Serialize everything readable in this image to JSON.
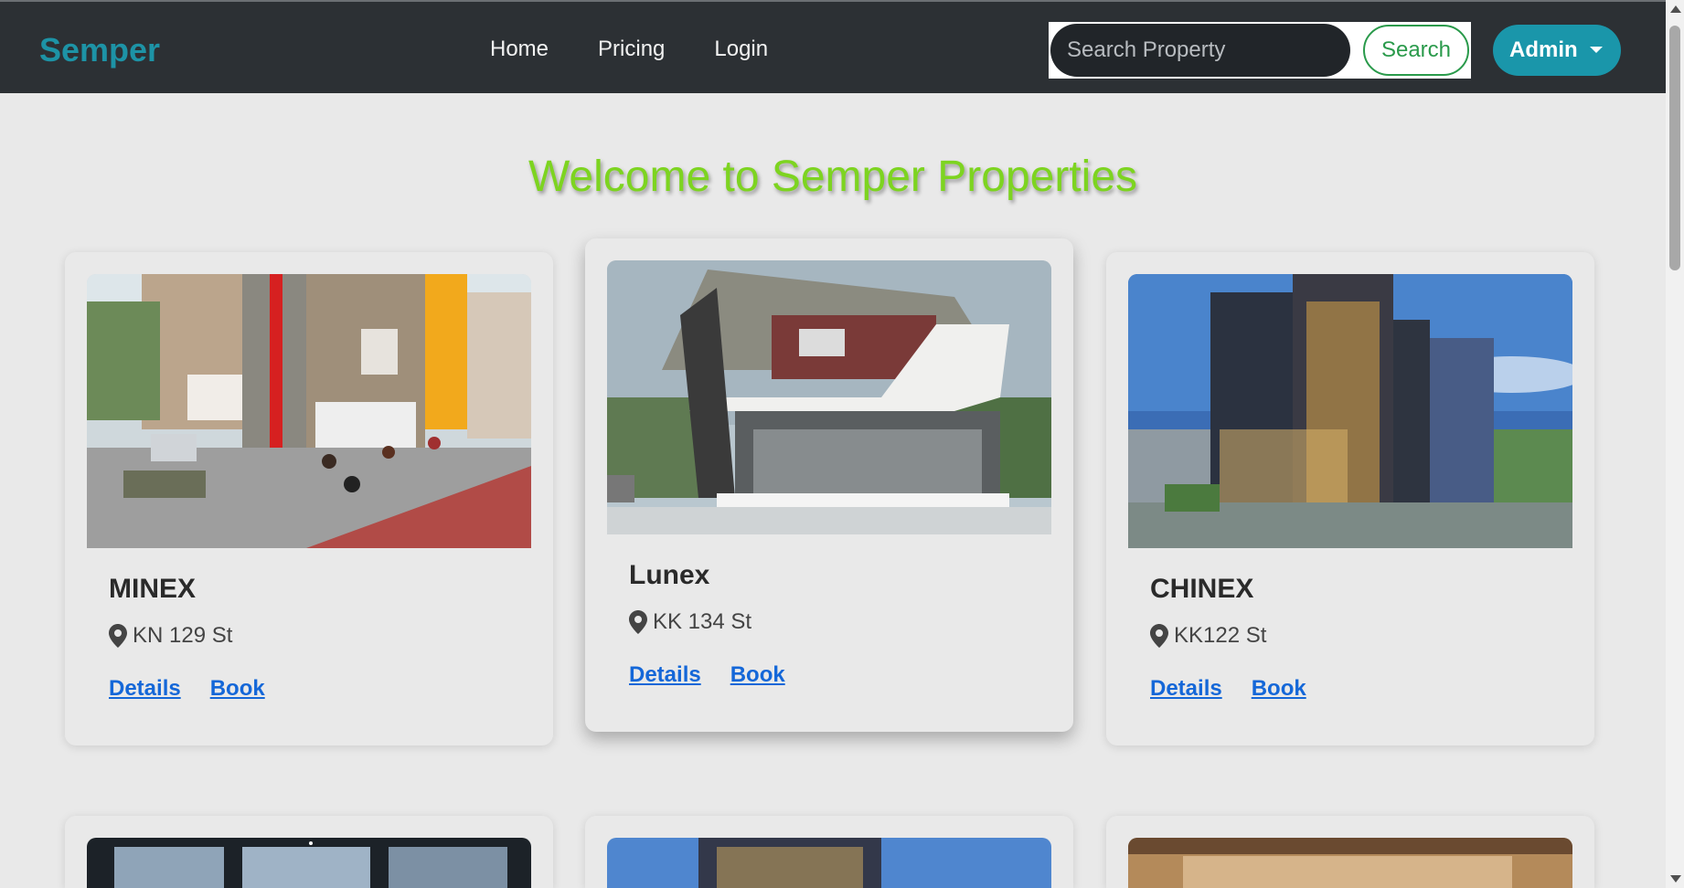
{
  "brand": "Semper",
  "nav": {
    "home": "Home",
    "pricing": "Pricing",
    "login": "Login"
  },
  "search": {
    "placeholder": "Search Property",
    "button": "Search"
  },
  "admin": {
    "label": "Admin"
  },
  "welcome": "Welcome to Semper Properties",
  "properties": [
    {
      "name": "MINEX",
      "location": "KN 129 St",
      "details": "Details",
      "book": "Book"
    },
    {
      "name": "Lunex",
      "location": "KK 134 St",
      "details": "Details",
      "book": "Book"
    },
    {
      "name": "CHINEX",
      "location": "KK122 St",
      "details": "Details",
      "book": "Book"
    }
  ],
  "colors": {
    "brand": "#1d93a6",
    "navbar": "#2c3034",
    "welcome": "#7dd420",
    "search_green": "#2a9a4b",
    "admin_teal": "#1a96aa",
    "link_blue": "#1467d8"
  }
}
